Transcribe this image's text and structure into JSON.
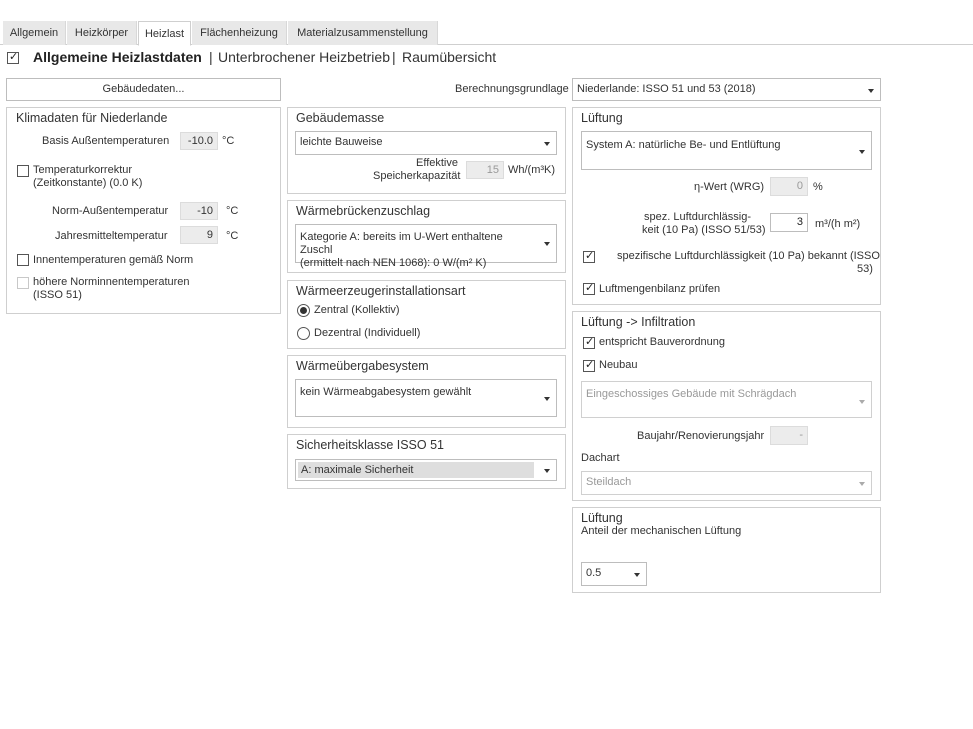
{
  "tabs": [
    "Allgemein",
    "Heizkörper",
    "Heizlast",
    "Flächenheizung",
    "Materialzusammenstellung"
  ],
  "header": {
    "title": "Allgemeine Heizlastdaten",
    "sep1": "|",
    "link1": "Unterbrochener Heizbetrieb",
    "sep2": "|",
    "link2": "Raumübersicht"
  },
  "left": {
    "gebaeude_button": "Gebäudedaten...",
    "klima_title": "Klimadaten für Niederlande",
    "basis_label": "Basis Außentemperaturen",
    "basis_value": "-10.0",
    "basis_unit": "°C",
    "tempkorr_line1": "Temperaturkorrektur",
    "tempkorr_line2": "(Zeitkonstante) (0.0 K)",
    "norm_label": "Norm-Außentemperatur",
    "norm_value": "-10",
    "norm_unit": "°C",
    "jahres_label": "Jahresmitteltemperatur",
    "jahres_value": "9",
    "jahres_unit": "°C",
    "innen_label": "Innentemperaturen gemäß Norm",
    "hoehere_line1": "höhere Norminnentemperaturen",
    "hoehere_line2": "(ISSO 51)"
  },
  "berechnung": {
    "label": "Berechnungsgrundlage",
    "value": "Niederlande: ISSO 51 und 53 (2018)"
  },
  "gebaeudemasse": {
    "title": "Gebäudemasse",
    "select": "leichte Bauweise",
    "eff_line1": "Effektive",
    "eff_line2": "Speicherkapazität",
    "eff_value": "15",
    "eff_unit": "Wh/(m³K)"
  },
  "waermebruecken": {
    "title": "Wärmebrückenzuschlag",
    "line1": "Kategorie A: bereits im U-Wert enthaltene Zuschl",
    "line2": "(ermittelt nach NEN 1068): 0 W/(m² K)"
  },
  "erzeuger": {
    "title": "Wärmeerzeugerinstallationsart",
    "opt1": "Zentral (Kollektiv)",
    "opt2": "Dezentral (Individuell)"
  },
  "uebergabe": {
    "title": "Wärmeübergabesystem",
    "select": "kein Wärmeabgabesystem gewählt"
  },
  "sicherheit": {
    "title": "Sicherheitsklasse ISSO 51",
    "select": "A: maximale Sicherheit"
  },
  "lueftung": {
    "title": "Lüftung",
    "select": "System A: natürliche Be- und Entlüftung",
    "eta_label": "η-Wert (WRG)",
    "eta_value": "0",
    "eta_unit": "%",
    "spez_line1": "spez. Luftdurchlässig-",
    "spez_line2": "keit (10 Pa) (ISSO 51/53)",
    "spez_value": "3",
    "spez_unit": "m³/(h m²)",
    "bekannt_line1": "spezifische Luftdurchlässigkeit (10 Pa) bekannt (ISSO",
    "bekannt_line2": "53)",
    "bilanz": "Luftmengenbilanz prüfen"
  },
  "infiltration": {
    "title": "Lüftung -> Infiltration",
    "bauverordnung": "entspricht Bauverordnung",
    "neubau": "Neubau",
    "gebaeude_select": "Eingeschossiges Gebäude mit Schrägdach",
    "baujahr_label": "Baujahr/Renovierungsjahr",
    "baujahr_value": "-",
    "dachart_label": "Dachart",
    "dachart_select": "Steildach"
  },
  "lueftung2": {
    "title": "Lüftung",
    "anteil_label": "Anteil der mechanischen Lüftung",
    "anteil_select": "0.5"
  }
}
